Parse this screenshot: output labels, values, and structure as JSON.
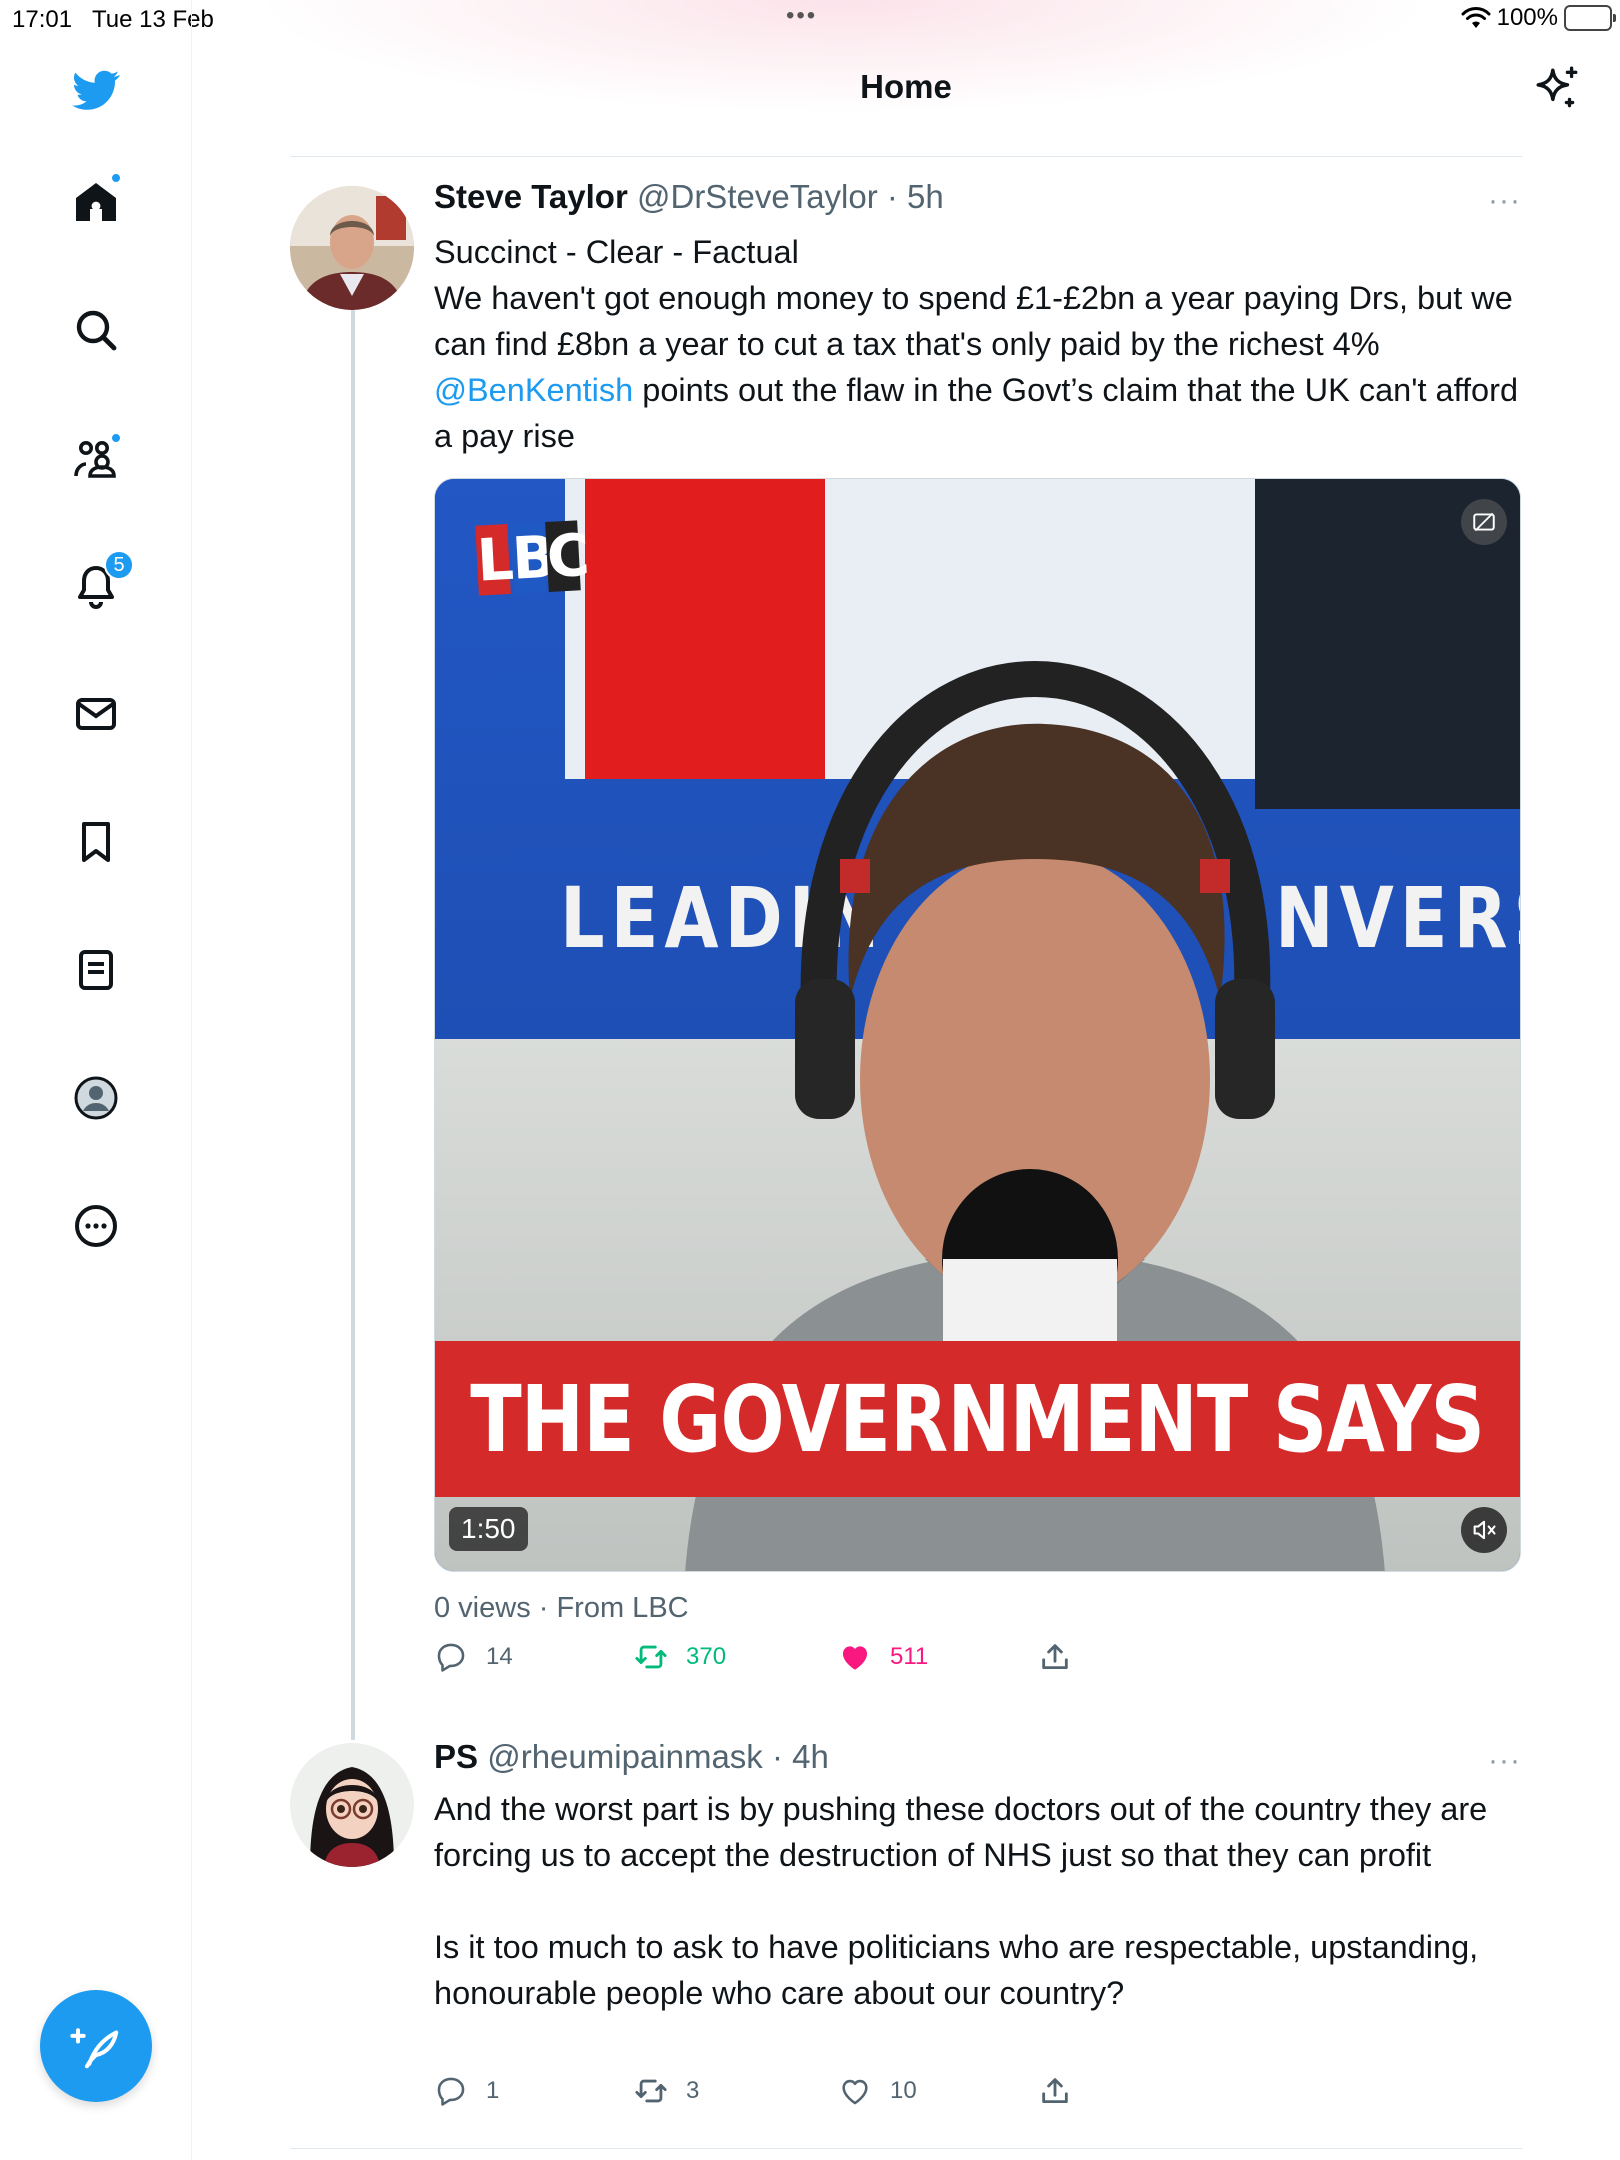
{
  "status_bar": {
    "time": "17:01",
    "date": "Tue 13 Feb",
    "battery": "100%",
    "center_dots": "•••"
  },
  "header": {
    "title": "Home"
  },
  "sidebar": {
    "items": [
      {
        "name": "home",
        "icon": "home-icon",
        "badge": "dot"
      },
      {
        "name": "explore",
        "icon": "search-icon"
      },
      {
        "name": "communities",
        "icon": "communities-icon",
        "badge": "dot"
      },
      {
        "name": "notifications",
        "icon": "bell-icon",
        "badge": "5"
      },
      {
        "name": "messages",
        "icon": "mail-icon"
      },
      {
        "name": "bookmarks",
        "icon": "bookmark-icon"
      },
      {
        "name": "lists",
        "icon": "lists-icon"
      },
      {
        "name": "profile",
        "icon": "profile-icon"
      },
      {
        "name": "more",
        "icon": "more-circle-icon"
      }
    ],
    "compose_icon": "compose-feather-icon"
  },
  "tweets": [
    {
      "name": "Steve Taylor",
      "handle": "@DrSteveTaylor",
      "time": "· 5h",
      "more": "···",
      "line1": "Succinct - Clear - Factual",
      "line2": "We haven't got enough money to spend £1-£2bn a year paying Drs, but we can find £8bn a year to cut a tax that's only paid by the richest 4%",
      "mention": "@BenKentish",
      "line3": " points out the flaw in the Govt’s claim that the UK can't afford a pay rise",
      "media": {
        "logo_letters": [
          "L",
          "B",
          "C"
        ],
        "bg_left_text": "LEADIN",
        "bg_right_text": "NVERSA",
        "banner": "THE GOVERNMENT SAYS",
        "duration": "1:50"
      },
      "meta": "0 views · From LBC",
      "replies": "14",
      "retweets": "370",
      "likes": "511",
      "liked": true,
      "retweeted": true
    },
    {
      "name": "PS",
      "handle": "@rheumipainmask",
      "time": "· 4h",
      "more": "···",
      "para1": "And the worst part is by pushing these doctors out of the country they are forcing us to accept the destruction of NHS just so that they can profit",
      "para2": "Is it too much to ask to have politicians who are respectable, upstanding, honourable people who care about our country?",
      "replies": "1",
      "retweets": "3",
      "likes": "10",
      "liked": false,
      "retweeted": false
    }
  ],
  "colors": {
    "accent": "#1d9bf0",
    "like": "#f91880",
    "retweet": "#00ba7c",
    "secondary_text": "#536471"
  }
}
